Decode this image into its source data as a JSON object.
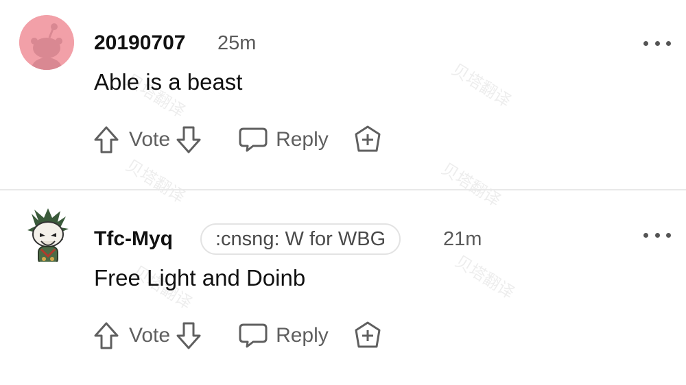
{
  "comments": [
    {
      "username": "20190707",
      "time": "25m",
      "flair": "",
      "text": "Able is a beast",
      "actions": {
        "vote": "Vote",
        "reply": "Reply"
      }
    },
    {
      "username": "Tfc-Myq",
      "time": "21m",
      "flair": ":cnsng: W for WBG",
      "text": "Free Light and Doinb",
      "actions": {
        "vote": "Vote",
        "reply": "Reply"
      }
    }
  ],
  "watermark": "贝塔翻译",
  "colors": {
    "avatar1_bg": "#f2a0a8",
    "text": "#111111",
    "muted": "#5f5f5f",
    "divider": "#e8e8e8"
  },
  "icons": [
    "reddit-snoo-avatar-icon",
    "character-avatar-icon",
    "more-options-icon",
    "upvote-arrow-icon",
    "downvote-arrow-icon",
    "reply-bubble-icon",
    "award-icon"
  ]
}
